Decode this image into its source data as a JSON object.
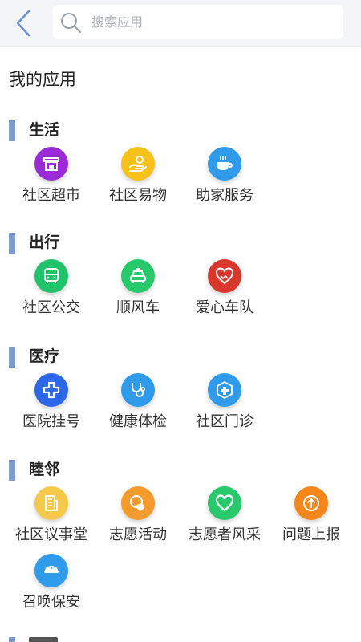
{
  "header": {
    "back_icon": "chevron-left-icon",
    "search": {
      "placeholder": "搜索应用",
      "value": "",
      "icon": "search-icon"
    }
  },
  "page_title": "我的应用",
  "colors": {
    "section_bar": "#7d9bd3",
    "back_icon": "#6a8fd6"
  },
  "sections": [
    {
      "title": "生活",
      "apps": [
        {
          "label": "社区超市",
          "icon": "storefront-icon",
          "color": "#9b2bd8"
        },
        {
          "label": "社区易物",
          "icon": "hand-coin-icon",
          "color": "#f5c11a"
        },
        {
          "label": "助家服务",
          "icon": "coffee-cup-icon",
          "color": "#2f9bea"
        }
      ]
    },
    {
      "title": "出行",
      "apps": [
        {
          "label": "社区公交",
          "icon": "bus-icon",
          "color": "#1fc46a"
        },
        {
          "label": "顺风车",
          "icon": "taxi-icon",
          "color": "#27c96a"
        },
        {
          "label": "爱心车队",
          "icon": "heart-handshake-icon",
          "color": "#d9362c"
        }
      ]
    },
    {
      "title": "医疗",
      "apps": [
        {
          "label": "医院挂号",
          "icon": "medical-cross-icon",
          "color": "#2c67e8"
        },
        {
          "label": "健康体检",
          "icon": "stethoscope-icon",
          "color": "#2f9bea"
        },
        {
          "label": "社区门诊",
          "icon": "clinic-cross-icon",
          "color": "#2f9bea"
        }
      ]
    },
    {
      "title": "睦邻",
      "apps": [
        {
          "label": "社区议事堂",
          "icon": "building-icon",
          "color": "#f5c84a"
        },
        {
          "label": "志愿活动",
          "icon": "volunteer-heart-icon",
          "color": "#f59a2c"
        },
        {
          "label": "志愿者风采",
          "icon": "heart-icon",
          "color": "#27c96a"
        },
        {
          "label": "问题上报",
          "icon": "upload-arrow-icon",
          "color": "#f5861a"
        },
        {
          "label": "召唤保安",
          "icon": "security-guard-icon",
          "color": "#2f9bea"
        }
      ]
    }
  ]
}
